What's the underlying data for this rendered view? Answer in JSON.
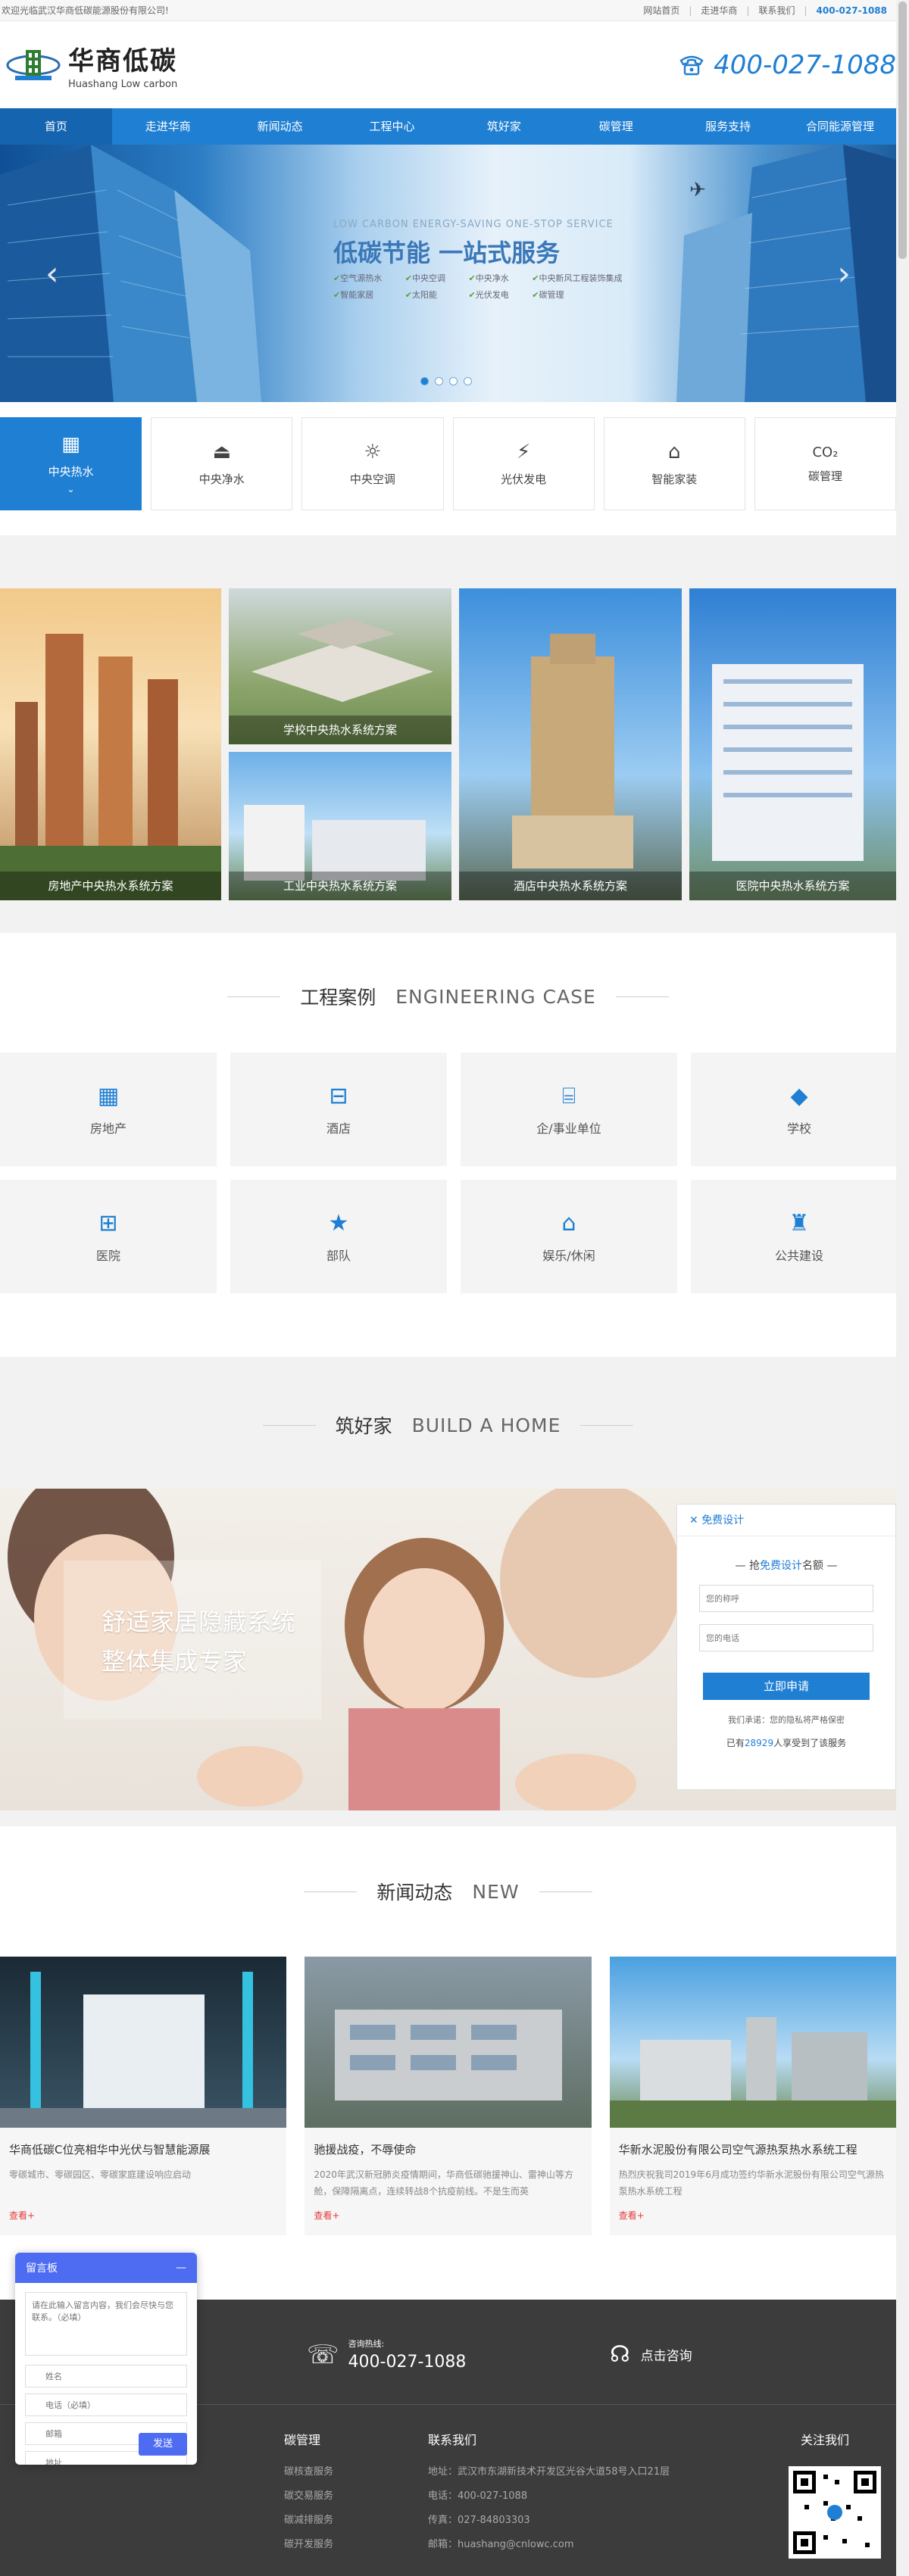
{
  "topbar": {
    "welcome": "欢迎光临武汉华商低碳能源股份有限公司!",
    "links": [
      "网站首页",
      "走进华商",
      "联系我们"
    ],
    "phone": "400-027-1088"
  },
  "header": {
    "logo_cn": "华商低碳",
    "logo_en": "Huashang Low carbon",
    "phone": "400-027-1088"
  },
  "nav": [
    "首页",
    "走进华商",
    "新闻动态",
    "工程中心",
    "筑好家",
    "碳管理",
    "服务支持",
    "合同能源管理"
  ],
  "banner": {
    "subtitle": "LOW CARBON ENERGY-SAVING ONE-STOP SERVICE",
    "title": "低碳节能 一站式服务",
    "features": [
      "空气源热水",
      "中央空调",
      "中央净水",
      "中央新风工程装饰集成",
      "智能家居",
      "太阳能",
      "光伏发电",
      "碳管理"
    ],
    "prev": "‹",
    "next": "›"
  },
  "services": [
    {
      "icon": "building-icon",
      "label": "中央热水"
    },
    {
      "icon": "water-icon",
      "label": "中央净水"
    },
    {
      "icon": "sun-icon",
      "label": "中央空调"
    },
    {
      "icon": "bulb-icon",
      "label": "光伏发电"
    },
    {
      "icon": "home-icon",
      "label": "智能家装"
    },
    {
      "icon": "co2-icon",
      "label": "碳管理",
      "glyph": "CO₂"
    }
  ],
  "solutions": [
    "房地产中央热水系统方案",
    "学校中央热水系统方案",
    "工业中央热水系统方案",
    "酒店中央热水系统方案",
    "医院中央热水系统方案"
  ],
  "cases": {
    "title_cn": "工程案例",
    "title_en": "ENGINEERING CASE",
    "items": [
      "房地产",
      "酒店",
      "企/事业单位",
      "学校",
      "医院",
      "部队",
      "娱乐/休闲",
      "公共建设"
    ]
  },
  "home": {
    "title_cn": "筑好家",
    "title_en": "BUILD A HOME",
    "slogan1": "舒适家居隐藏系统",
    "slogan2": "整体集成专家",
    "form": {
      "header": "免费设计",
      "sub_pre": "抢",
      "sub_hl": "免费设计",
      "sub_post": "名额",
      "name_ph": "您的称呼",
      "phone_ph": "您的电话",
      "button": "立即申请",
      "note": "我们承诺：您的隐私将严格保密",
      "count_pre": "已有",
      "count": "28929",
      "count_post": "人享受到了该服务"
    }
  },
  "news": {
    "title_cn": "新闻动态",
    "title_en": "NEW",
    "items": [
      {
        "title": "华商低碳C位亮相华中光伏与智慧能源展",
        "desc": "零碳城市、零碳园区、零碳家庭建设响应启动",
        "more": "查看+"
      },
      {
        "title": "驰援战疫，不辱使命",
        "desc": "2020年武汉新冠肺炎疫情期间，华商低碳驰援神山、雷神山等方舱，保障隔离点，连续转战8个抗疫前线。不是生而英",
        "more": "查看+"
      },
      {
        "title": "华新水泥股份有限公司空气源热泵热水系统工程",
        "desc": "热烈庆祝我司2019年6月成功签约华新水泥股份有限公司空气源热泵热水系统工程",
        "more": "查看+"
      }
    ]
  },
  "footer": {
    "call_label": "咨询热线:",
    "call_number": "400-027-1088",
    "consult": "点击咨询",
    "col1": {
      "title": "碳管理",
      "items": [
        "碳核查服务",
        "碳交易服务",
        "碳减排服务",
        "碳开发服务"
      ]
    },
    "col2": {
      "title": "联系我们",
      "items": [
        "地址：武汉市东湖新技术开发区光谷大道58号入口21层",
        "电话：400-027-1088",
        "传真：027-84803303",
        "邮箱：huashang@cnlowc.com"
      ]
    },
    "col3": {
      "title": "关注我们"
    }
  },
  "message": {
    "title": "留言板",
    "min": "—",
    "textarea_ph": "请在此输入留言内容，我们会尽快与您联系。（必填）",
    "name_ph": "姓名",
    "phone_ph": "电话（必填）",
    "email_ph": "邮箱",
    "address_ph": "地址",
    "send": "发送"
  }
}
